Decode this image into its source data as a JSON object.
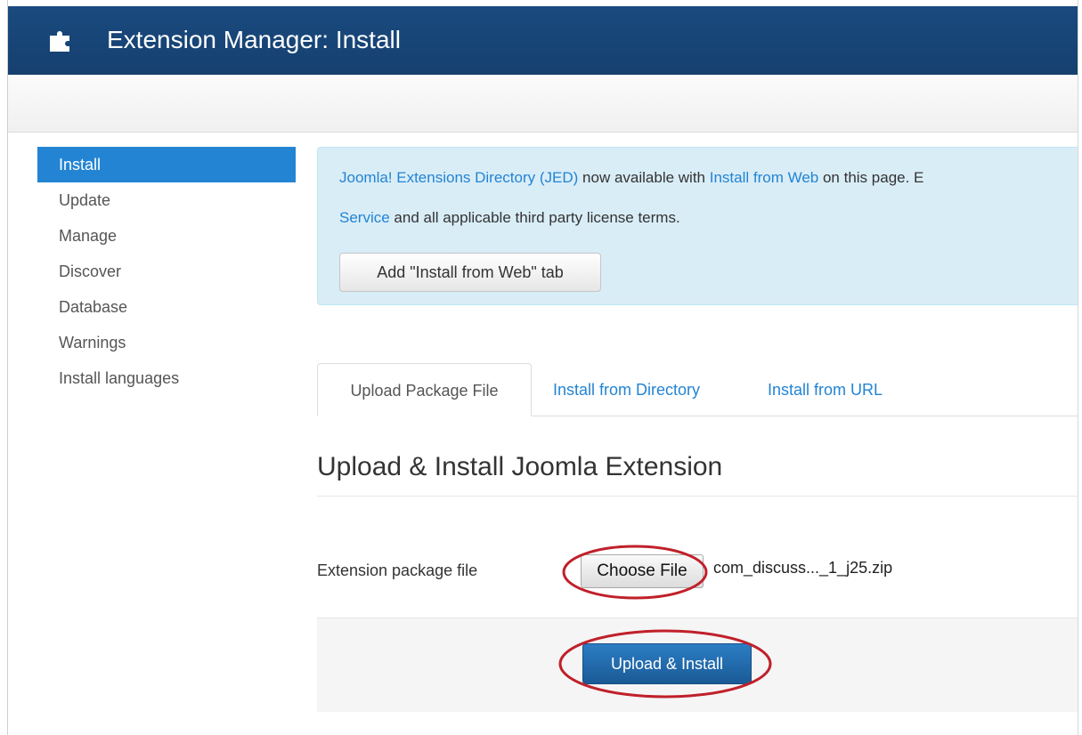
{
  "header": {
    "title": "Extension Manager: Install",
    "icon": "puzzle-icon"
  },
  "sidebar": {
    "items": [
      {
        "label": "Install",
        "active": true
      },
      {
        "label": "Update",
        "active": false
      },
      {
        "label": "Manage",
        "active": false
      },
      {
        "label": "Discover",
        "active": false
      },
      {
        "label": "Database",
        "active": false
      },
      {
        "label": "Warnings",
        "active": false
      },
      {
        "label": "Install languages",
        "active": false
      }
    ]
  },
  "alert": {
    "jed_link": "Joomla! Extensions Directory (JED)",
    "text_1": " now available with ",
    "install_web_link": "Install from Web",
    "text_2": " on this page.  E",
    "service_link": "Service",
    "text_3": " and all applicable third party license terms.",
    "button_label": "Add \"Install from Web\" tab"
  },
  "tabs": [
    {
      "label": "Upload Package File",
      "active": true
    },
    {
      "label": "Install from Directory",
      "active": false
    },
    {
      "label": "Install from URL",
      "active": false
    }
  ],
  "form": {
    "section_title": "Upload & Install Joomla Extension",
    "field_label": "Extension package file",
    "choose_file_label": "Choose File",
    "file_name": "com_discuss..._1_j25.zip",
    "submit_label": "Upload & Install"
  },
  "colors": {
    "header": "#1a4a7f",
    "accent": "#2384d3",
    "alert_bg": "#d9edf7",
    "annotation": "#c0202a"
  }
}
